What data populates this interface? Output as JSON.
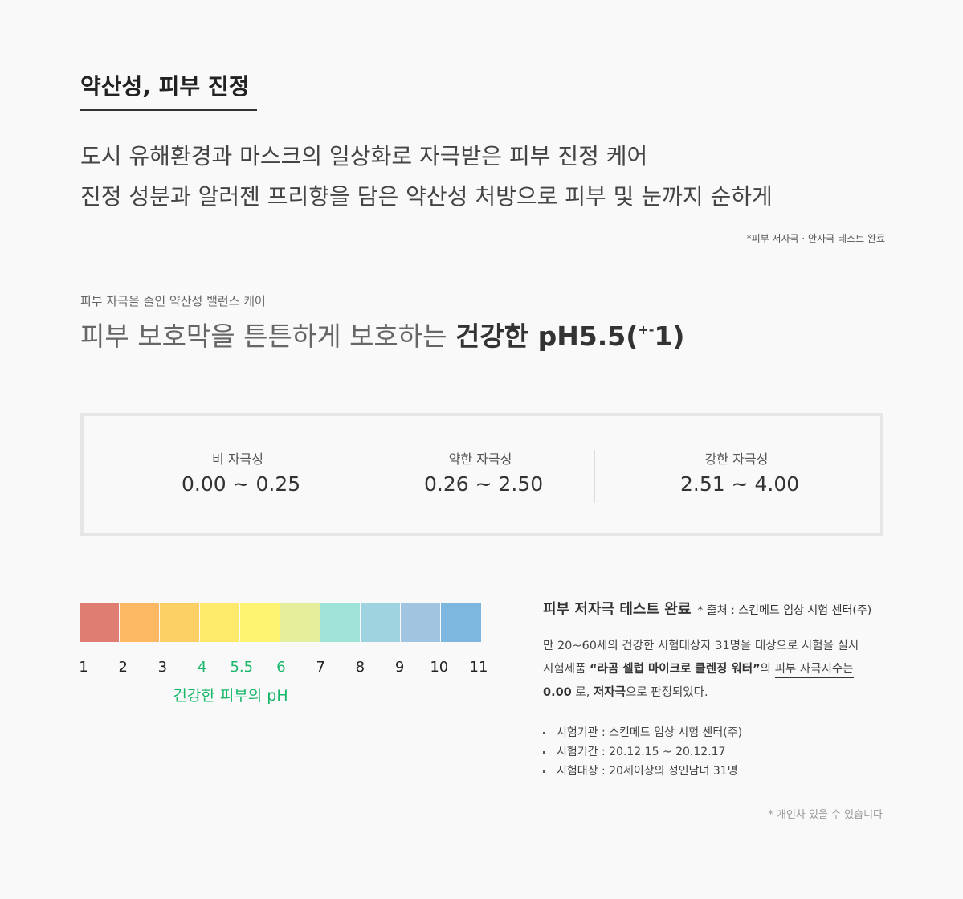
{
  "section_title": "약산성, 피부 진정",
  "intro": {
    "line1": "도시 유해환경과 마스크의 일상화로 자극받은 피부 진정 케어",
    "line2": "진정 성분과 알러젠 프리향을 담은 약산성 처방으로 피부 및 눈까지 순하게"
  },
  "test_note_top": "*피부 저자극 · 안자극 테스트 완료",
  "ph_intro": {
    "sub_label": "피부 자극을 줄인 약산성 밸런스 케어",
    "headline_light": "피부 보호막을 튼튼하게 보호하는 ",
    "headline_strong": "건강한 pH5.5(",
    "headline_sup": "+-",
    "headline_end": "1)"
  },
  "irritation_levels": [
    {
      "label": "비 자극성",
      "range": "0.00 ~ 0.25"
    },
    {
      "label": "약한 자극성",
      "range": "0.26 ~ 2.50"
    },
    {
      "label": "강한 자극성",
      "range": "2.51 ~ 4.00"
    }
  ],
  "ph_scale": {
    "colors": [
      "#e07d72",
      "#fdb863",
      "#fdd066",
      "#fdea6a",
      "#fef472",
      "#e5ef9b",
      "#a0e3d8",
      "#9fd3df",
      "#a1c4e0",
      "#7db7e0"
    ],
    "ticks": [
      {
        "label": "1",
        "value": 1
      },
      {
        "label": "2",
        "value": 2
      },
      {
        "label": "3",
        "value": 3
      },
      {
        "label": "4",
        "value": 4,
        "highlight": true
      },
      {
        "label": "5.5",
        "value": 5.5,
        "highlight": true
      },
      {
        "label": "6",
        "value": 6,
        "highlight": true
      },
      {
        "label": "7",
        "value": 7
      },
      {
        "label": "8",
        "value": 8
      },
      {
        "label": "9",
        "value": 9
      },
      {
        "label": "10",
        "value": 10
      },
      {
        "label": "11",
        "value": 11
      }
    ],
    "caption": "건강한 피부의 pH",
    "highlight_color": "#19b76a"
  },
  "test": {
    "title": "피부 저자극 테스트 완료",
    "source": "* 출처 : 스킨메드 임상 시험 센터(주)",
    "desc_line1": "만 20~60세의 건강한 시험대상자 31명을 대상으로 시험을 실시",
    "desc_prefix": "시험제품 ",
    "product": "“라곰 셀럽 마이크로 클렌징 워터”",
    "desc_mid": "의 ",
    "index_label": "피부 자극지수는",
    "score": "0.00",
    "desc_mid2": " 로, ",
    "verdict": "저자극",
    "desc_end": "으로 판정되었다.",
    "details": [
      "시험기관 : 스킨메드 임상 시험 센터(주)",
      "시험기간 : 20.12.15 ~ 20.12.17",
      "시험대상 : 20세이상의 성인남녀 31명"
    ]
  },
  "note_bottom": "* 개인차 있을 수 있습니다"
}
